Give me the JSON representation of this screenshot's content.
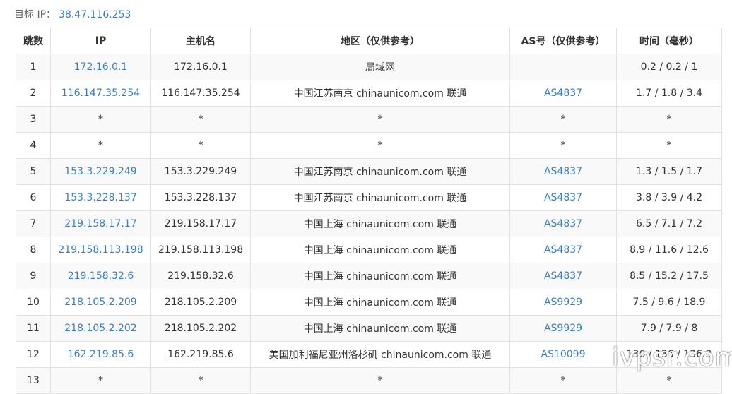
{
  "target": {
    "label": "目标 IP：",
    "ip": "38.47.116.253"
  },
  "columns": [
    "跳数",
    "IP",
    "主机名",
    "地区（仅供参考）",
    "AS号（仅供参考）",
    "时间（毫秒）"
  ],
  "rows": [
    {
      "hop": "1",
      "ip": "172.16.0.1",
      "host": "172.16.0.1",
      "region": "局域网",
      "as": "",
      "time": "0.2 / 0.2 / 1"
    },
    {
      "hop": "2",
      "ip": "116.147.35.254",
      "host": "116.147.35.254",
      "region": "中国江苏南京 chinaunicom.com 联通",
      "as": "AS4837",
      "time": "1.7 / 1.8 / 3.4"
    },
    {
      "hop": "3",
      "ip": "*",
      "host": "*",
      "region": "*",
      "as": "*",
      "time": "*"
    },
    {
      "hop": "4",
      "ip": "*",
      "host": "*",
      "region": "*",
      "as": "*",
      "time": "*"
    },
    {
      "hop": "5",
      "ip": "153.3.229.249",
      "host": "153.3.229.249",
      "region": "中国江苏南京 chinaunicom.com 联通",
      "as": "AS4837",
      "time": "1.3 / 1.5 / 1.7"
    },
    {
      "hop": "6",
      "ip": "153.3.228.137",
      "host": "153.3.228.137",
      "region": "中国江苏南京 chinaunicom.com 联通",
      "as": "AS4837",
      "time": "3.8 / 3.9 / 4.2"
    },
    {
      "hop": "7",
      "ip": "219.158.17.17",
      "host": "219.158.17.17",
      "region": "中国上海 chinaunicom.com 联通",
      "as": "AS4837",
      "time": "6.5 / 7.1 / 7.2"
    },
    {
      "hop": "8",
      "ip": "219.158.113.198",
      "host": "219.158.113.198",
      "region": "中国上海 chinaunicom.com 联通",
      "as": "AS4837",
      "time": "8.9 / 11.6 / 12.6"
    },
    {
      "hop": "9",
      "ip": "219.158.32.6",
      "host": "219.158.32.6",
      "region": "中国上海 chinaunicom.com 联通",
      "as": "AS4837",
      "time": "8.5 / 15.2 / 17.5"
    },
    {
      "hop": "10",
      "ip": "218.105.2.209",
      "host": "218.105.2.209",
      "region": "中国上海 chinaunicom.com 联通",
      "as": "AS9929",
      "time": "7.5 / 9.6 / 18.9"
    },
    {
      "hop": "11",
      "ip": "218.105.2.202",
      "host": "218.105.2.202",
      "region": "中国上海 chinaunicom.com 联通",
      "as": "AS9929",
      "time": "7.9 / 7.9 / 8"
    },
    {
      "hop": "12",
      "ip": "162.219.85.6",
      "host": "162.219.85.6",
      "region": "美国加利福尼亚州洛杉矶 chinaunicom.com 联通",
      "as": "AS10099",
      "time": "136 / 136 / 136.3"
    },
    {
      "hop": "13",
      "ip": "*",
      "host": "*",
      "region": "*",
      "as": "*",
      "time": "*"
    }
  ],
  "watermark": "ivpsr.com",
  "colors": {
    "link": "#3a7fc1",
    "border": "#e2e2e2",
    "stripe": "#f9f9f9"
  }
}
